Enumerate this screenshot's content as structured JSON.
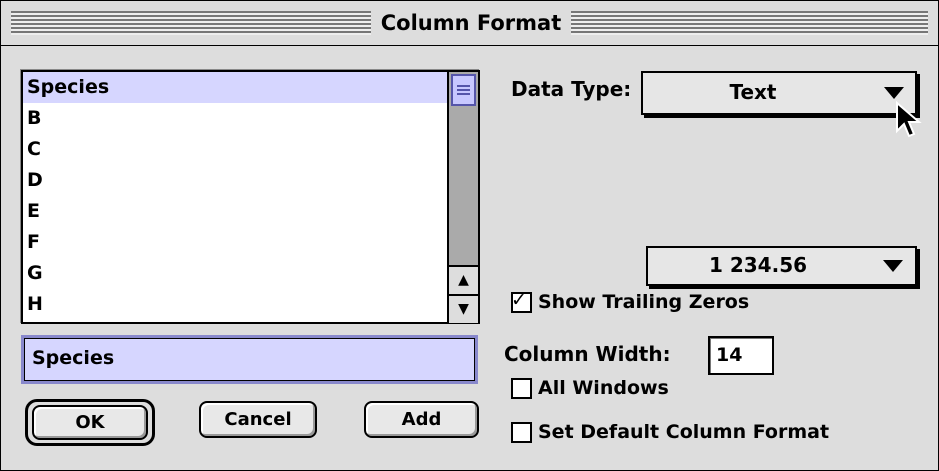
{
  "dialog": {
    "title": "Column Format"
  },
  "column_list": {
    "items": [
      "Species",
      "B",
      "C",
      "D",
      "E",
      "F",
      "G",
      "H"
    ],
    "selected_index": 0
  },
  "name_field": {
    "value": "Species"
  },
  "buttons": {
    "ok": "OK",
    "cancel": "Cancel",
    "add": "Add"
  },
  "data_type": {
    "label": "Data Type:",
    "value": "Text"
  },
  "number_format": {
    "value": "1 234.56"
  },
  "show_trailing_zeros": {
    "label": "Show Trailing Zeros",
    "checked": true
  },
  "column_width": {
    "label": "Column Width:",
    "value": "14"
  },
  "all_windows": {
    "label": "All Windows",
    "checked": false
  },
  "set_default": {
    "label": "Set Default Column Format",
    "checked": false
  },
  "icons": {
    "popup_arrow": "triangle-down",
    "scroll_up": "arrow-up",
    "scroll_down": "arrow-down",
    "cursor": "arrow-pointer",
    "scroll_thumb": "grip-lines"
  },
  "colors": {
    "selection": "#d6d6ff",
    "background": "#dddddd"
  }
}
